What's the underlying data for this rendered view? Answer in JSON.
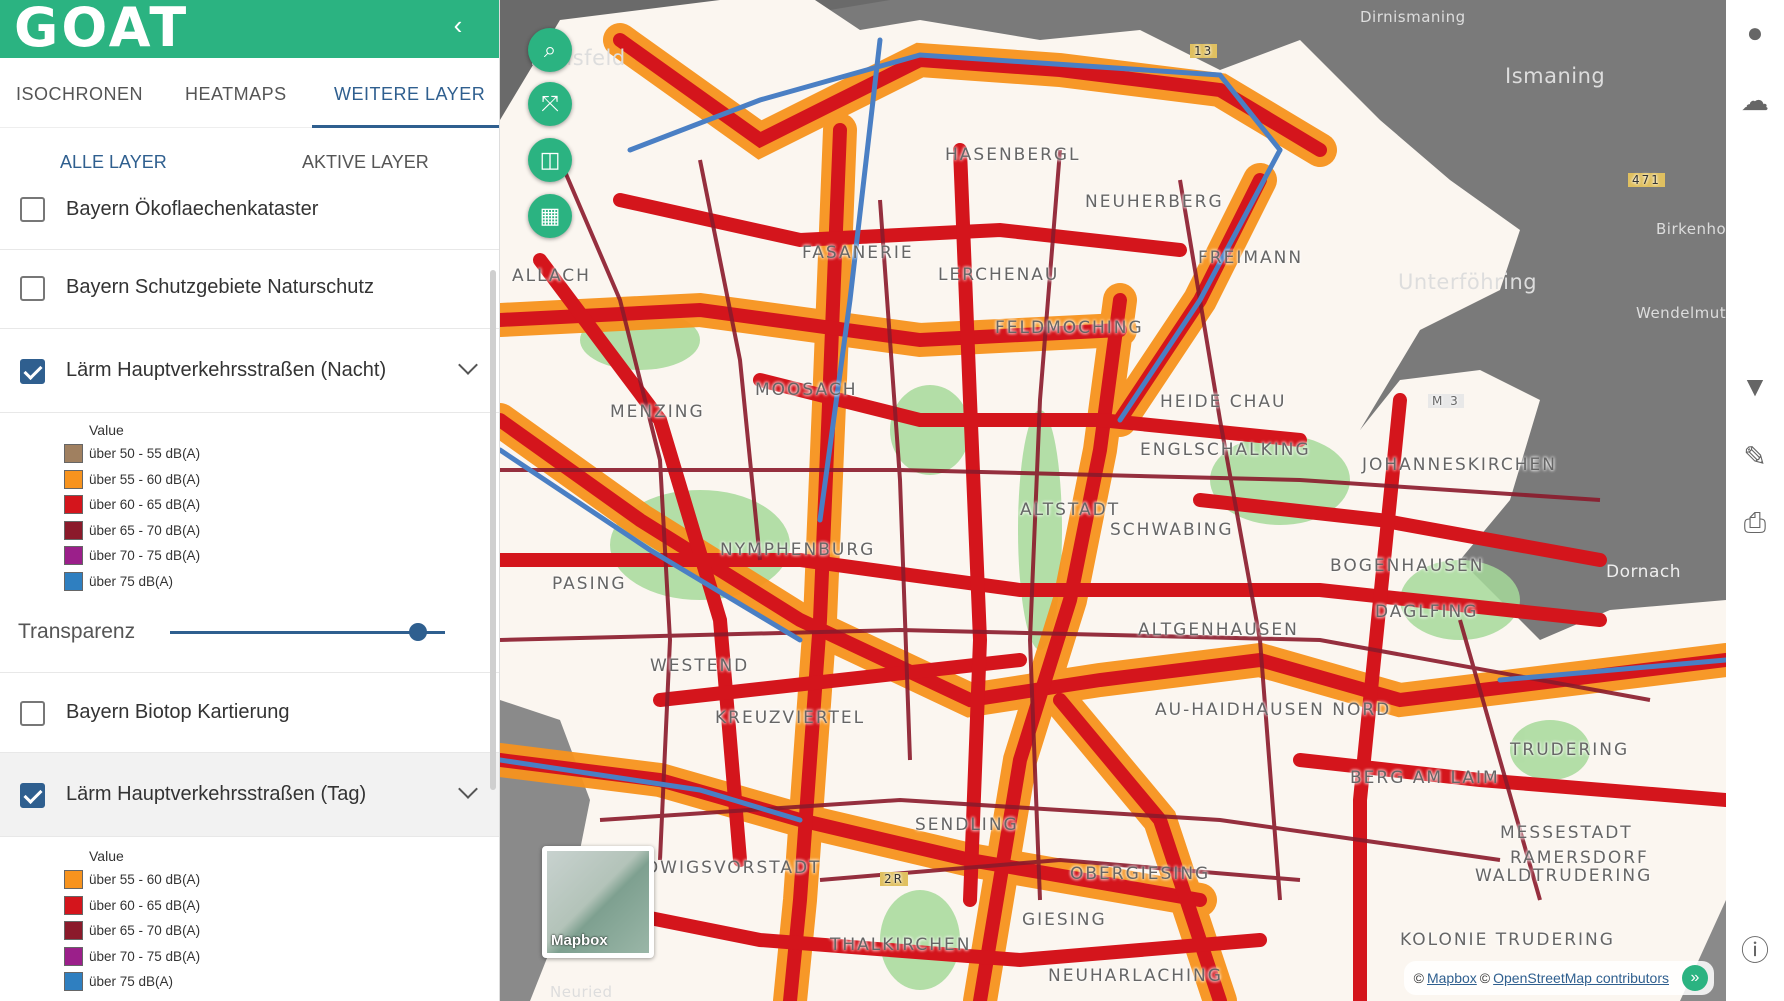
{
  "app": {
    "logo": "GOAT"
  },
  "tabs": [
    "ISOCHRONEN",
    "HEATMAPS",
    "WEITERE LAYER"
  ],
  "subtabs": [
    "ALLE LAYER",
    "AKTIVE LAYER"
  ],
  "layers": [
    {
      "label": "Bayern Ökoflaechenkataster",
      "checked": false
    },
    {
      "label": "Bayern Schutzgebiete Naturschutz",
      "checked": false
    },
    {
      "label": "Lärm Hauptverkehrsstraßen (Nacht)",
      "checked": true
    },
    {
      "label": "Bayern Biotop Kartierung",
      "checked": false
    },
    {
      "label": "Lärm Hauptverkehrsstraßen (Tag)",
      "checked": true
    }
  ],
  "legend_night": {
    "title": "Value",
    "items": [
      {
        "label": "über 50 - 55 dB(A)",
        "color": "#a08060"
      },
      {
        "label": "über 55 - 60 dB(A)",
        "color": "#f7931e"
      },
      {
        "label": "über 60 - 65 dB(A)",
        "color": "#d4151c"
      },
      {
        "label": "über 65 - 70 dB(A)",
        "color": "#8b1a2b"
      },
      {
        "label": "über 70 - 75 dB(A)",
        "color": "#9b1f8a"
      },
      {
        "label": "über 75 dB(A)",
        "color": "#2f7fc0"
      }
    ]
  },
  "legend_day": {
    "title": "Value",
    "items": [
      {
        "label": "über 55 - 60 dB(A)",
        "color": "#f7931e"
      },
      {
        "label": "über 60 - 65 dB(A)",
        "color": "#d4151c"
      },
      {
        "label": "über 65 - 70 dB(A)",
        "color": "#8b1a2b"
      },
      {
        "label": "über 70 - 75 dB(A)",
        "color": "#9b1f8a"
      },
      {
        "label": "über 75 dB(A)",
        "color": "#2f7fc0"
      }
    ]
  },
  "transparency": {
    "label": "Transparenz",
    "value": 0.9
  },
  "map_labels": [
    "Karlsfeld",
    "Dirnismaning",
    "Ismaning",
    "HASENBERGL",
    "NEUHERBERG",
    "FREIMANN",
    "FASANERIE",
    "LERCHENAU",
    "Unterföhring",
    "Birkenhof",
    "Wendelmuth",
    "ALLACH",
    "FELDMOCHING",
    "MOOSACH",
    "MENZING",
    "HEIDE CHAU",
    "ENGLSCHALKING",
    "JOHANNESKIRCHEN",
    "NYMPHENBURG",
    "PASING",
    "ALTSTADT",
    "SCHWABING",
    "BOGENHAUSEN",
    "DAGLFING",
    "Dornach",
    "WESTEND",
    "ALTGENHAUSEN",
    "AU-HAIDHAUSEN NORD",
    "SENDLING",
    "BERG AM LAIM",
    "TRUDERING",
    "OBERGIESING",
    "GIESING",
    "NEUHARLACHING",
    "THALKIRCHEN",
    "KREUZVIERTEL",
    "LUDWIGSVORSTADT",
    "RAMERSDORF",
    "WALDTRUDERING",
    "MESSESTADT",
    "KOLONIE TRUDERING",
    "Neuried",
    "M 3",
    "13",
    "471",
    "2R"
  ],
  "basemap": {
    "label": "Mapbox"
  },
  "attribution": {
    "prefix": "©",
    "mapbox": "Mapbox",
    "mid": "©",
    "osm": "OpenStreetMap contributors",
    "more": "»"
  },
  "icons": {
    "collapse": "chevron-left-icon",
    "search": "search-icon",
    "fullscreen": "fullscreen-icon",
    "measure": "ruler-icon",
    "layers": "map-icon",
    "user": "user-icon",
    "cloud": "cloud-icon",
    "filter": "filter-icon",
    "edit": "edit-icon",
    "print": "print-icon",
    "info": "info-icon"
  }
}
